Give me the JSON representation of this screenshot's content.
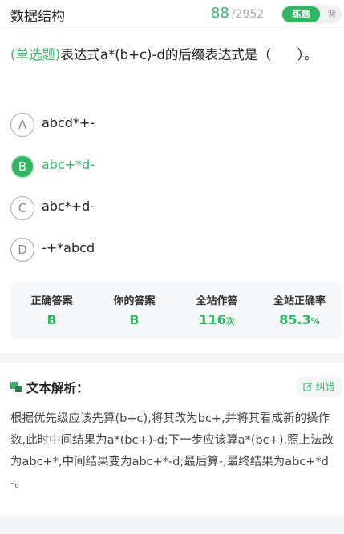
{
  "header": {
    "title": "数据结构",
    "current": "88",
    "separator": "/",
    "total": "2952",
    "mode_practice": "练题",
    "mode_memorize": "背"
  },
  "question": {
    "type_label": "(单选题)",
    "stem": "表达式a*(b+c)-d的后缀表达式是（　　）。"
  },
  "options": [
    {
      "letter": "A",
      "text": "abcd*+-",
      "selected": false
    },
    {
      "letter": "B",
      "text": "abc+*d-",
      "selected": true
    },
    {
      "letter": "C",
      "text": "abc*+d-",
      "selected": false
    },
    {
      "letter": "D",
      "text": "-+*abcd",
      "selected": false
    }
  ],
  "stats": {
    "correct_answer_label": "正确答案",
    "correct_answer": "B",
    "your_answer_label": "你的答案",
    "your_answer": "B",
    "site_attempts_label": "全站作答",
    "site_attempts": "116",
    "site_attempts_unit": "次",
    "site_accuracy_label": "全站正确率",
    "site_accuracy": "85.3",
    "site_accuracy_unit": "%"
  },
  "analysis": {
    "icon": "analysis-icon",
    "title": "文本解析：",
    "report_label": "纠错",
    "body": "根据优先级应该先算(b+c),将其改为bc+,并将其看成新的操作数,此时中间结果为a*(bc+)-d;下一步应该算a*(bc+),照上法改为abc+*,中间结果变为abc+*-d;最后算-,最终结果为abc+*d-。"
  },
  "colors": {
    "accent": "#33b663",
    "muted": "#aaaaaa",
    "stats_bg": "#f6f7f8"
  }
}
